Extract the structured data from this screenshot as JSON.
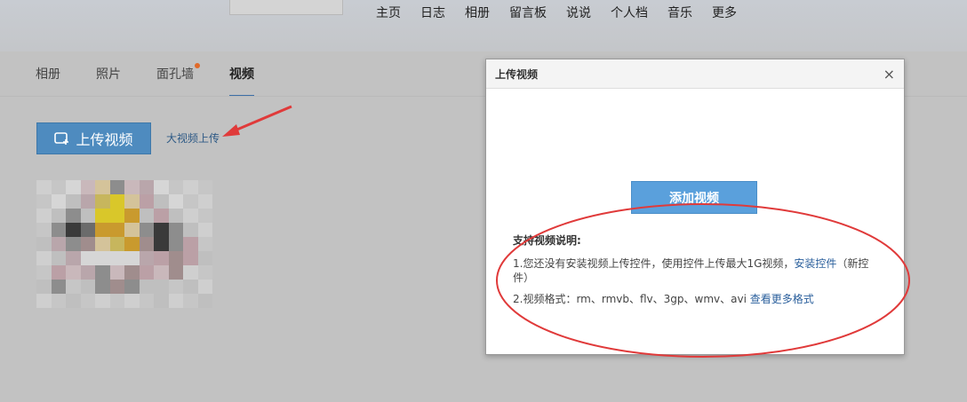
{
  "nav": {
    "items": [
      "主页",
      "日志",
      "相册",
      "留言板",
      "说说",
      "个人档",
      "音乐",
      "更多"
    ]
  },
  "subtabs": {
    "items": [
      "相册",
      "照片",
      "面孔墙",
      "视频"
    ],
    "active": "视频"
  },
  "upload": {
    "button_label": "上传视频",
    "big_upload_link": "大视频上传"
  },
  "dialog": {
    "title": "上传视频",
    "close": "×",
    "add_button": "添加视频",
    "support_title": "支持视频说明:",
    "line1_text": "1.您还没有安装视频上传控件，使用控件上传最大1G视频，",
    "line1_link": "安装控件",
    "line1_suffix": "（新控件）",
    "line2_text": "2.视频格式：rm、rmvb、flv、3gp、wmv、avi ",
    "line2_link": "查看更多格式"
  },
  "colors": {
    "accent": "#4e8bbf",
    "annotation": "#e03a3a",
    "badge": "#e06a2a"
  },
  "icons": {
    "upload": "video-upload-icon",
    "close": "close-icon"
  },
  "thumbnail": {
    "description": "pixelated video thumbnail"
  }
}
